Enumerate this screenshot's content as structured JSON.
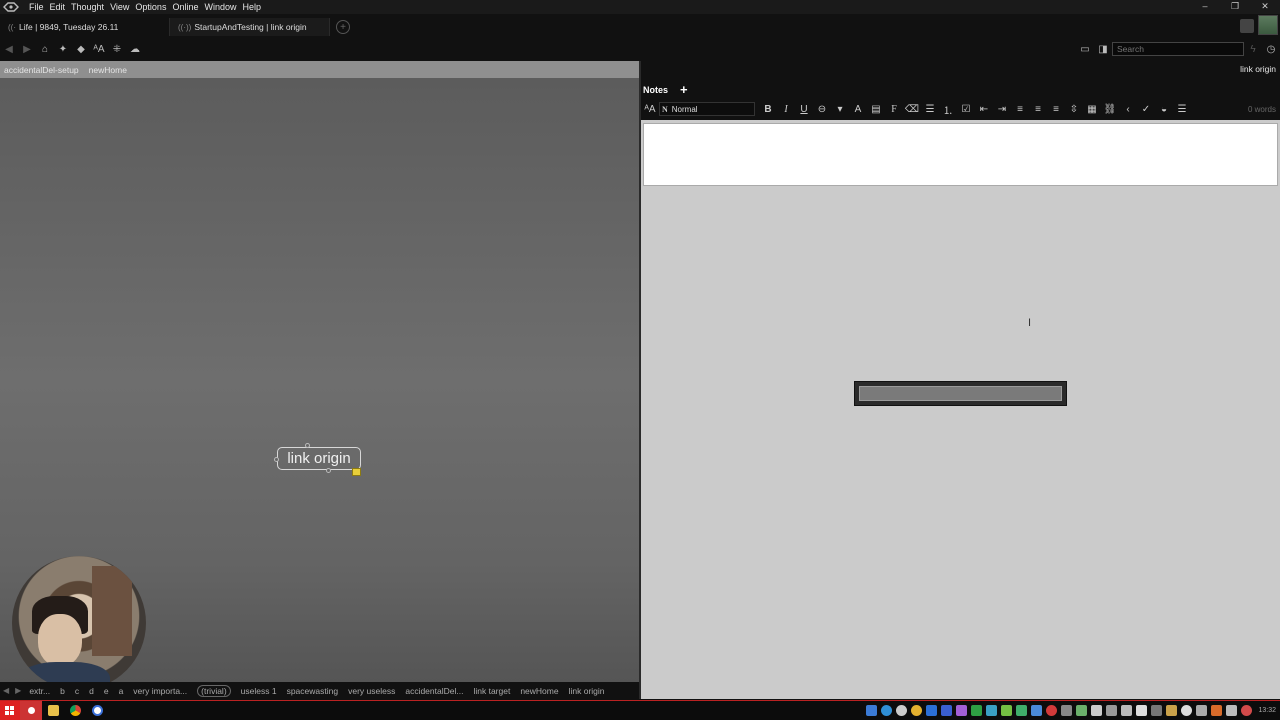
{
  "menubar": {
    "items": [
      "File",
      "Edit",
      "Thought",
      "View",
      "Options",
      "Online",
      "Window",
      "Help"
    ],
    "window_controls": [
      "–",
      "❐",
      "✕"
    ]
  },
  "tabs": [
    {
      "label": "Life | 9849, Tuesday 26.11"
    },
    {
      "label": "StartupAndTesting | link origin"
    }
  ],
  "search": {
    "placeholder": "Search"
  },
  "plex": {
    "breadcrumbs": [
      "accidentalDel-setup",
      "newHome"
    ],
    "active_thought": "link origin",
    "bottom_items": [
      "extr...",
      "b",
      "c",
      "d",
      "e",
      "a",
      "very importa...",
      "(trivial)",
      "useless 1",
      "spacewasting",
      "very useless",
      "accidentalDel...",
      "link target",
      "newHome",
      "link origin"
    ]
  },
  "notes": {
    "thought_title": "link origin",
    "tab_label": "Notes",
    "add_label": "+",
    "style_value": "Normal",
    "word_count": "0 words",
    "progress": 0.0
  },
  "taskbar": {
    "clock": "13:32"
  }
}
